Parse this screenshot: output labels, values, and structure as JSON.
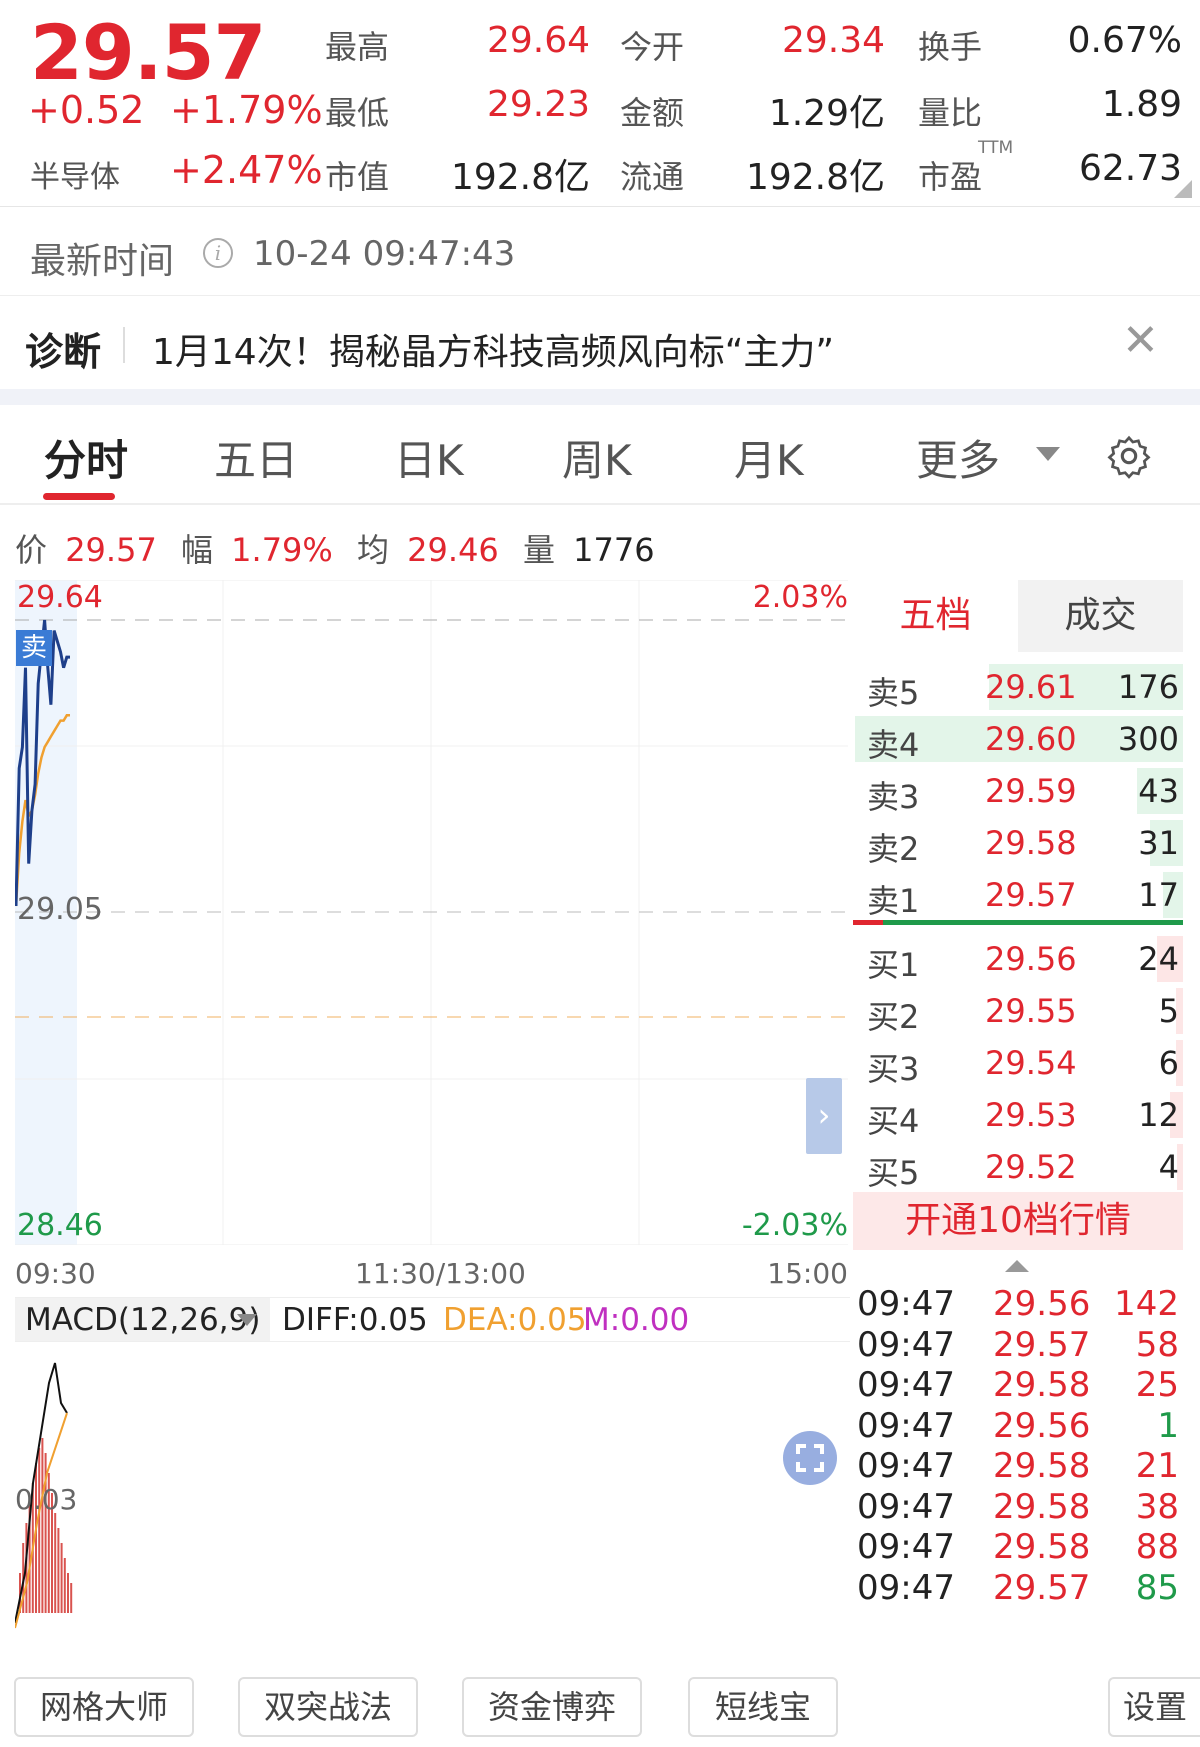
{
  "quote": {
    "price": "29.57",
    "change": "+0.52",
    "change_pct": "+1.79%",
    "sector": "半导体",
    "sector_pct": "+2.47%",
    "fields": [
      {
        "label": "最高",
        "value": "29.64",
        "color": "red"
      },
      {
        "label": "今开",
        "value": "29.34",
        "color": "red"
      },
      {
        "label": "换手",
        "value": "0.67%",
        "color": "black"
      },
      {
        "label": "最低",
        "value": "29.23",
        "color": "red"
      },
      {
        "label": "金额",
        "value": "1.29亿",
        "color": "black"
      },
      {
        "label": "量比",
        "value": "1.89",
        "color": "black"
      },
      {
        "label": "市值",
        "value": "192.8亿",
        "color": "black"
      },
      {
        "label": "流通",
        "value": "192.8亿",
        "color": "black"
      },
      {
        "label": "市盈",
        "value": "62.73",
        "color": "black"
      }
    ],
    "ttm_sup": "TTM"
  },
  "latest_time": {
    "label": "最新时间",
    "value": "10-24 09:47:43",
    "icon": "info-icon"
  },
  "diagnosis": {
    "label": "诊断",
    "text": "1月14次！揭秘晶方科技高频风向标“主力”",
    "close_icon": "close-icon"
  },
  "tabs": [
    "分时",
    "五日",
    "日K",
    "周K",
    "月K",
    "更多"
  ],
  "settings_icon": "gear-icon",
  "info": {
    "price_label": "价",
    "price": "29.57",
    "amp_label": "幅",
    "amp": "1.79%",
    "avg_label": "均",
    "avg": "29.46",
    "vol_label": "量",
    "vol": "1776"
  },
  "chart": {
    "high_label": "29.64",
    "mid_label": "29.05",
    "low_label": "28.46",
    "high_pct": "2.03%",
    "low_pct": "-2.03%",
    "sell_badge": "卖",
    "time_axis": [
      "09:30",
      "11:30/13:00",
      "15:00"
    ],
    "expand_icon": "chevron-right-icon"
  },
  "chart_data": {
    "type": "line",
    "title": "",
    "ylim": [
      28.46,
      29.64
    ],
    "x": [
      "09:30",
      "09:31",
      "09:32",
      "09:33",
      "09:34",
      "09:35",
      "09:36",
      "09:37",
      "09:38",
      "09:39",
      "09:40",
      "09:41",
      "09:42",
      "09:43",
      "09:44",
      "09:45",
      "09:46",
      "09:47"
    ],
    "series": [
      {
        "values": [
          29.1,
          29.36,
          29.4,
          29.55,
          29.18,
          29.28,
          29.33,
          29.52,
          29.58,
          29.64,
          29.55,
          29.48,
          29.62,
          29.6,
          29.58,
          29.55,
          29.57,
          29.57
        ]
      },
      {
        "values": [
          29.1,
          29.2,
          29.26,
          29.3,
          29.27,
          29.28,
          29.31,
          29.35,
          29.38,
          29.4,
          29.41,
          29.42,
          29.43,
          29.44,
          29.45,
          29.45,
          29.46,
          29.46
        ]
      }
    ],
    "vol_volumes": []
  },
  "order_book": {
    "tabs": [
      "五档",
      "成交"
    ],
    "asks": [
      {
        "label": "卖5",
        "price": "29.61",
        "vol": "176",
        "ratio": 0.59
      },
      {
        "label": "卖4",
        "price": "29.60",
        "vol": "300",
        "ratio": 1.0
      },
      {
        "label": "卖3",
        "price": "29.59",
        "vol": "43",
        "ratio": 0.14
      },
      {
        "label": "卖2",
        "price": "29.58",
        "vol": "31",
        "ratio": 0.1
      },
      {
        "label": "卖1",
        "price": "29.57",
        "vol": "17",
        "ratio": 0.06
      }
    ],
    "bids": [
      {
        "label": "买1",
        "price": "29.56",
        "vol": "24",
        "ratio": 0.08
      },
      {
        "label": "买2",
        "price": "29.55",
        "vol": "5",
        "ratio": 0.02
      },
      {
        "label": "买3",
        "price": "29.54",
        "vol": "6",
        "ratio": 0.02
      },
      {
        "label": "买4",
        "price": "29.53",
        "vol": "12",
        "ratio": 0.04
      },
      {
        "label": "买5",
        "price": "29.52",
        "vol": "4",
        "ratio": 0.01
      }
    ],
    "open10": "开通10档行情"
  },
  "macd": {
    "name": "MACD(12,26,9)",
    "diff": "DIFF:0.05",
    "dea": "DEA:0.05",
    "m": "M:0.00",
    "zero_label": "0.03"
  },
  "trades": [
    {
      "time": "09:47",
      "price": "29.56",
      "vol": "142",
      "color": "red"
    },
    {
      "time": "09:47",
      "price": "29.57",
      "vol": "58",
      "color": "red"
    },
    {
      "time": "09:47",
      "price": "29.58",
      "vol": "25",
      "color": "red"
    },
    {
      "time": "09:47",
      "price": "29.56",
      "vol": "1",
      "color": "green"
    },
    {
      "time": "09:47",
      "price": "29.58",
      "vol": "21",
      "color": "red"
    },
    {
      "time": "09:47",
      "price": "29.58",
      "vol": "38",
      "color": "red"
    },
    {
      "time": "09:47",
      "price": "29.58",
      "vol": "88",
      "color": "red"
    },
    {
      "time": "09:47",
      "price": "29.57",
      "vol": "85",
      "color": "green"
    }
  ],
  "bottom_buttons": [
    "网格大师",
    "双突战法",
    "资金博弈",
    "短线宝",
    "设置"
  ],
  "fullscreen_icon": "fullscreen-icon",
  "colors": {
    "up": "#e0262f",
    "down": "#1f9a4a",
    "price_line": "#1e3f8a",
    "avg_line": "#f0a030"
  }
}
